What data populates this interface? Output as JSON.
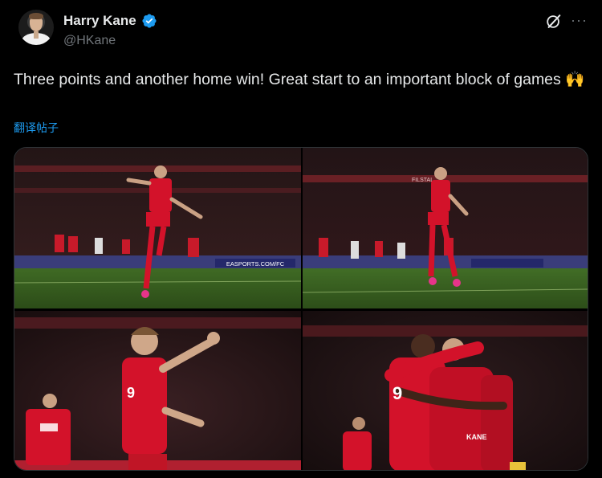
{
  "user": {
    "display_name": "Harry Kane",
    "handle": "@HKane",
    "verified": true,
    "avatar_alt": "avatar"
  },
  "actions": {
    "grok_icon": "grok-icon",
    "more_label": "···"
  },
  "tweet": {
    "text": "Three points and another home win! Great start to an important block of games 🙌",
    "translate_label": "翻译帖子"
  },
  "media": {
    "ad_board": "EASPORTS.COM/FC",
    "stadium_banner": "FILSTAL"
  },
  "colors": {
    "background": "#000000",
    "text": "#e7e9ea",
    "muted": "#71767b",
    "link": "#1d9bf0",
    "verified": "#1d9bf0",
    "kit_red": "#d3122a"
  }
}
